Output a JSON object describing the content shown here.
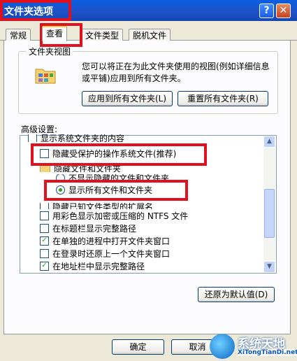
{
  "window": {
    "title": "文件夹选项",
    "help_glyph": "?",
    "close_glyph": "✕"
  },
  "tabs": [
    {
      "label": "常规",
      "active": false
    },
    {
      "label": "查看",
      "active": true
    },
    {
      "label": "文件类型",
      "active": false
    },
    {
      "label": "脱机文件",
      "active": false
    }
  ],
  "folder_views": {
    "group_label": "文件夹视图",
    "description": "您可以将正在为此文件夹使用的视图(例如详细信息或平铺)应用到所有文件夹。",
    "apply_all_label": "应用到所有文件夹(L)",
    "reset_all_label": "重置所有文件夹(R)"
  },
  "advanced": {
    "label": "高级设置:",
    "items": [
      {
        "text": "显示系统文件夹的内容",
        "type": "checkbox",
        "checked": false
      },
      {
        "text": "隐藏受保护的操作系统文件(推荐)",
        "type": "checkbox",
        "checked": false
      },
      {
        "text": "隐藏文件和文件夹",
        "type": "folder"
      },
      {
        "text": "不显示隐藏的文件和文件夹",
        "type": "radio",
        "checked": false
      },
      {
        "text": "显示所有文件和文件夹",
        "type": "radio",
        "checked": true
      },
      {
        "text": "隐藏已知文件类型的扩展名",
        "type": "checkbox",
        "checked": false
      },
      {
        "text": "用彩色显示加密或压缩的 NTFS 文件",
        "type": "checkbox",
        "checked": false
      },
      {
        "text": "在标题栏显示完整路径",
        "type": "checkbox",
        "checked": false
      },
      {
        "text": "在单独的进程中打开文件夹窗口",
        "type": "checkbox",
        "checked": true
      },
      {
        "text": "在登录时还原上一个文件夹窗口",
        "type": "checkbox",
        "checked": false
      },
      {
        "text": "在地址栏中显示完整路径",
        "type": "checkbox",
        "checked": true
      }
    ]
  },
  "restore_defaults_label": "还原为默认值(D)",
  "ok_label": "确定",
  "cancel_label": "取消",
  "watermark": {
    "brand": "系统天地",
    "url": "XiTongTianDi.net"
  },
  "colors": {
    "highlight": "#e0101e",
    "titlebar": "#1f52c8",
    "check": "#21a121"
  }
}
